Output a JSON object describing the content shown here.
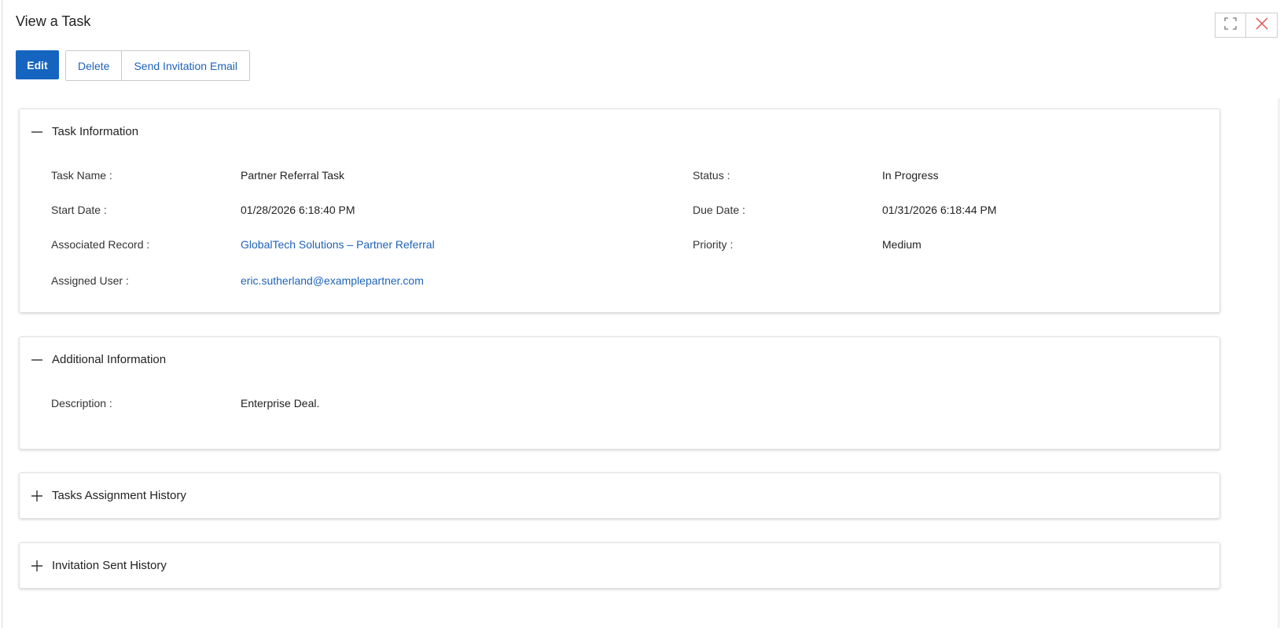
{
  "modal": {
    "title": "View a Task",
    "icons": {
      "maximize": "maximize-icon",
      "close": "close-icon"
    }
  },
  "toolbar": {
    "edit_label": "Edit",
    "delete_label": "Delete",
    "send_invite_label": "Send Invitation Email"
  },
  "colors": {
    "primary": "#1565c0",
    "link": "#1e63b8",
    "close_icon": "#e05555"
  },
  "task_info": {
    "title": "Task Information",
    "toggle_icon": "minus-icon",
    "task_name_label": "Task Name :",
    "task_name_value": "Partner Referral Task",
    "status_label": "Status :",
    "status_value": "In Progress",
    "start_date_label": "Start Date :",
    "start_date_value": "01/28/2026 6:18:40 PM",
    "due_date_label": "Due Date :",
    "due_date_value": "01/31/2026 6:18:44 PM",
    "associated_record_label": "Associated Record :",
    "associated_record_value": "GlobalTech Solutions – Partner Referral",
    "priority_label": "Priority :",
    "priority_value": "Medium",
    "assigned_user_label": "Assigned User :",
    "assigned_user_value": "eric.sutherland@examplepartner.com"
  },
  "additional_info": {
    "title": "Additional Information",
    "toggle_icon": "minus-icon",
    "description_label": "Description :",
    "description_value": "Enterprise Deal."
  },
  "assignment_history": {
    "title": "Tasks Assignment History",
    "toggle_icon": "plus-icon"
  },
  "invitation_history": {
    "title": "Invitation Sent History",
    "toggle_icon": "plus-icon"
  }
}
